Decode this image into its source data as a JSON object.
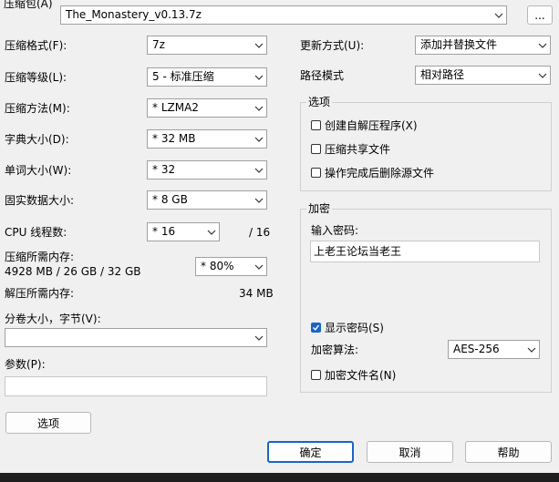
{
  "archive": {
    "label": "压缩包(A)",
    "value": "The_Monastery_v0.13.7z",
    "browse_label": "..."
  },
  "left": {
    "format": {
      "label": "压缩格式(F):",
      "value": "7z"
    },
    "level": {
      "label": "压缩等级(L):",
      "value": "5 - 标准压缩"
    },
    "method": {
      "label": "压缩方法(M):",
      "value": "*  LZMA2"
    },
    "dict": {
      "label": "字典大小(D):",
      "value": "*  32 MB"
    },
    "word": {
      "label": "单词大小(W):",
      "value": "*  32"
    },
    "solid": {
      "label": "固实数据大小:",
      "value": "*  8 GB"
    },
    "threads": {
      "label": "CPU 线程数:",
      "value": "*  16",
      "max": "/ 16"
    },
    "mem_compress": {
      "label": "压缩所需内存:",
      "detail": "4928 MB / 26 GB / 32 GB",
      "value": "*  80%"
    },
    "mem_decompress": {
      "label": "解压所需内存:",
      "value": "34 MB"
    },
    "split": {
      "label": "分卷大小，字节(V):",
      "value": ""
    },
    "params": {
      "label": "参数(P):",
      "value": ""
    },
    "options_button": "选项"
  },
  "right": {
    "update": {
      "label": "更新方式(U):",
      "value": "添加并替换文件"
    },
    "path": {
      "label": "路径模式",
      "value": "相对路径"
    },
    "options": {
      "title": "选项",
      "sfx": {
        "label": "创建自解压程序(X)",
        "checked": false
      },
      "shared": {
        "label": "压缩共享文件",
        "checked": false
      },
      "delete": {
        "label": "操作完成后删除源文件",
        "checked": false
      }
    },
    "encryption": {
      "title": "加密",
      "password_label": "输入密码:",
      "password_value": "上老王论坛当老王",
      "show_password": {
        "label": "显示密码(S)",
        "checked": true
      },
      "method_label": "加密算法:",
      "method_value": "AES-256",
      "encrypt_names": {
        "label": "加密文件名(N)",
        "checked": false
      }
    }
  },
  "buttons": {
    "ok": "确定",
    "cancel": "取消",
    "help": "帮助"
  }
}
